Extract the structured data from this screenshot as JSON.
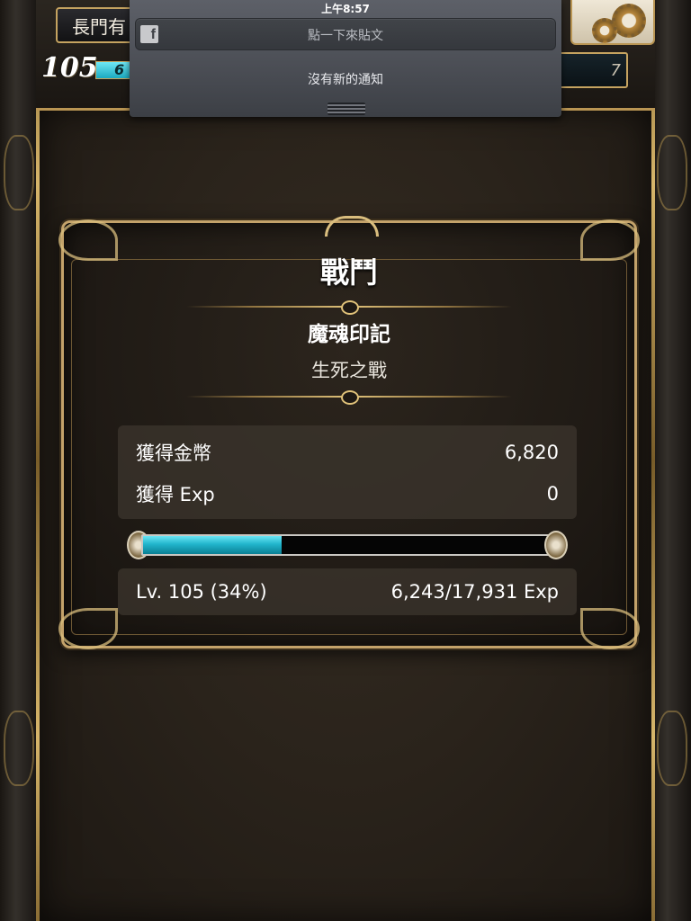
{
  "header": {
    "title_partial": "長門有",
    "player_level": "105",
    "hp_partial": "6",
    "right_partial": "7"
  },
  "notification_center": {
    "time": "上午8:57",
    "facebook_icon": "facebook-icon",
    "post_label": "點一下來貼文",
    "empty_message": "沒有新的通知"
  },
  "dialog": {
    "title": "戰鬥",
    "stage_name": "魔魂印記",
    "mission_name": "生死之戰",
    "rewards": [
      {
        "label": "獲得金幣",
        "value": "6,820"
      },
      {
        "label": "獲得 Exp",
        "value": "0"
      }
    ],
    "exp_progress": 0.34,
    "level_text": "Lv. 105 (34%)",
    "exp_text": "6,243/17,931 Exp"
  },
  "colors": {
    "exp_fill": "#21b5cc",
    "gold_trim": "#c3a26a"
  }
}
